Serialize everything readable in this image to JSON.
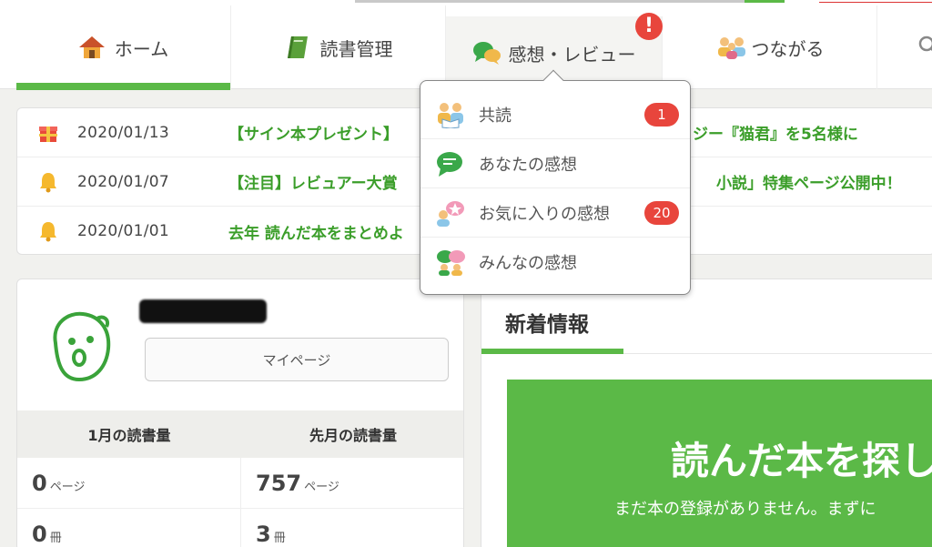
{
  "nav": {
    "tabs": [
      {
        "label": "ホーム",
        "icon": "house-icon"
      },
      {
        "label": "読書管理",
        "icon": "book-icon"
      },
      {
        "label": "感想・レビュー",
        "icon": "speech-bubbles-icon",
        "alert": "!"
      },
      {
        "label": "つながる",
        "icon": "people-icon"
      }
    ],
    "search_icon": "search-icon"
  },
  "dropdown": {
    "items": [
      {
        "label": "共読",
        "icon": "people-reading-icon",
        "count": "1"
      },
      {
        "label": "あなたの感想",
        "icon": "chat-icon",
        "count": ""
      },
      {
        "label": "お気に入りの感想",
        "icon": "favorite-review-icon",
        "count": "20"
      },
      {
        "label": "みんなの感想",
        "icon": "group-chat-icon",
        "count": ""
      }
    ]
  },
  "news": [
    {
      "date": "2020/01/13",
      "icon": "gift-icon",
      "title": "【サイン本プレゼント】",
      "tail": "ジー『猫君』を5名様に"
    },
    {
      "date": "2020/01/07",
      "icon": "bell-icon",
      "title": "【注目】レビュアー大賞",
      "tail": "小説」特集ページ公開中！"
    },
    {
      "date": "2020/01/01",
      "icon": "bell-icon",
      "title": "去年 読んだ本をまとめよ",
      "tail": ""
    }
  ],
  "profile": {
    "mypage_label": "マイページ",
    "stats_headers": [
      "1月の読書量",
      "先月の読書量"
    ],
    "rows": [
      [
        {
          "num": "0",
          "unit": "ページ"
        },
        {
          "num": "757",
          "unit": "ページ"
        }
      ],
      [
        {
          "num": "0",
          "unit": "冊"
        },
        {
          "num": "3",
          "unit": "冊"
        }
      ]
    ]
  },
  "info": {
    "tab_label": "新着情報",
    "banner_title": "読んだ本を探し",
    "banner_sub": "まだ本の登録がありません。まずに"
  },
  "colors": {
    "brand_green": "#5bb947",
    "link_green": "#3b9e2a",
    "badge_red": "#e8453c"
  }
}
